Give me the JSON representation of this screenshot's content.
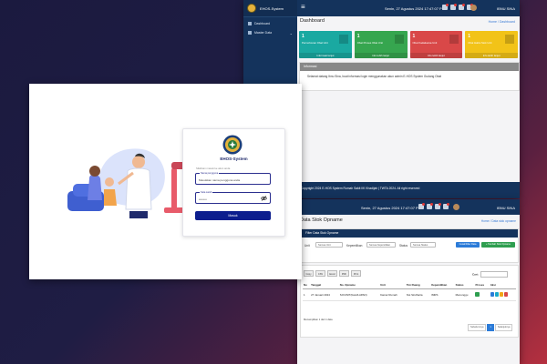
{
  "dashboard": {
    "brand": "EHOS-System",
    "nav": [
      {
        "label": "Dashboard",
        "icon": "dashboard-icon"
      },
      {
        "label": "Master Data",
        "icon": "folder-icon"
      }
    ],
    "topbar": {
      "date": "Senin, 27 Agustus 2024 17:47:07 PM",
      "user": "IBNU SINA"
    },
    "title": "Dashboard",
    "breadcrumb": "Home / Dashboard",
    "cards": [
      {
        "value": "1",
        "label": "Permohonan Obat Unit",
        "footer": "Informasi lanjut",
        "color": "#1aa9a1"
      },
      {
        "value": "1",
        "label": "Obat Proses Obat Unit",
        "footer": "Info lebih lanjut",
        "color": "#36a64f"
      },
      {
        "value": "1",
        "label": "Obat Kadaluarsa Unit",
        "footer": "Info lebih lanjut",
        "color": "#d94848"
      },
      {
        "value": "1",
        "label": "Obat Habis Stok Unit",
        "footer": "Info lebih lanjut",
        "color": "#f2c318"
      }
    ],
    "info": {
      "heading": "Informasi",
      "body": "Selamat datang Ibnu Sina, buat informasi login menggunakan akun admin E-HOS System Gudang Obat"
    },
    "footer": "Copyright 2024 E-HOS System Rumah Sakit IIK Khadijah | TWTA 2024. All right reserved"
  },
  "stock": {
    "topbar": {
      "date": "Senin, 27 Agustus 2024 17:47:07 PM",
      "user": "IBNU SINA"
    },
    "title": "Data Stok Opname",
    "breadcrumb": "Home / Data stok opname",
    "filter": {
      "heading": "Filter Data Stok Opname",
      "unit_label": "Unit",
      "unit_value": "Semua Unit",
      "kepemilikan_label": "Kepemilikan",
      "kepemilikan_value": "Semua Kepemilikan",
      "status_label": "Status",
      "status_value": "Semua Status",
      "cetak_label": "Cetak/Filter Data",
      "tambah_label": "+ Tambah Stok Opname"
    },
    "export_buttons": [
      "Copy",
      "CSV",
      "Excel",
      "PDF",
      "Print"
    ],
    "search_label": "Cari:",
    "columns": [
      "No",
      "Tanggal",
      "No. Opname",
      "Unit",
      "Tim Ruang",
      "Kepemilikan",
      "Status",
      "Proses",
      "Aksi"
    ],
    "rows": [
      {
        "no": "1",
        "tanggal": "27 Januari 2024",
        "no_opname": "SO/UNIT/(Hari/LAPAN)",
        "unit": "Kamar Rumah",
        "tim": "Not Sindharta",
        "kepemilikan": "IMRS",
        "status": "Menunggu"
      }
    ],
    "showing": "Menampilkan 1 dari 1 data",
    "pager": {
      "prev": "Sebelumnya",
      "current": "1",
      "next": "Selanjutnya"
    }
  },
  "login": {
    "app_name": "EHOS-System",
    "subtitle": "Silahkan masuk ke akun anda",
    "username_label": "Nama pengguna",
    "username_value": "Masukkan nama pengguna anda",
    "password_label": "Kata sandi",
    "password_value": "••••••••",
    "submit_label": "Masuk"
  }
}
